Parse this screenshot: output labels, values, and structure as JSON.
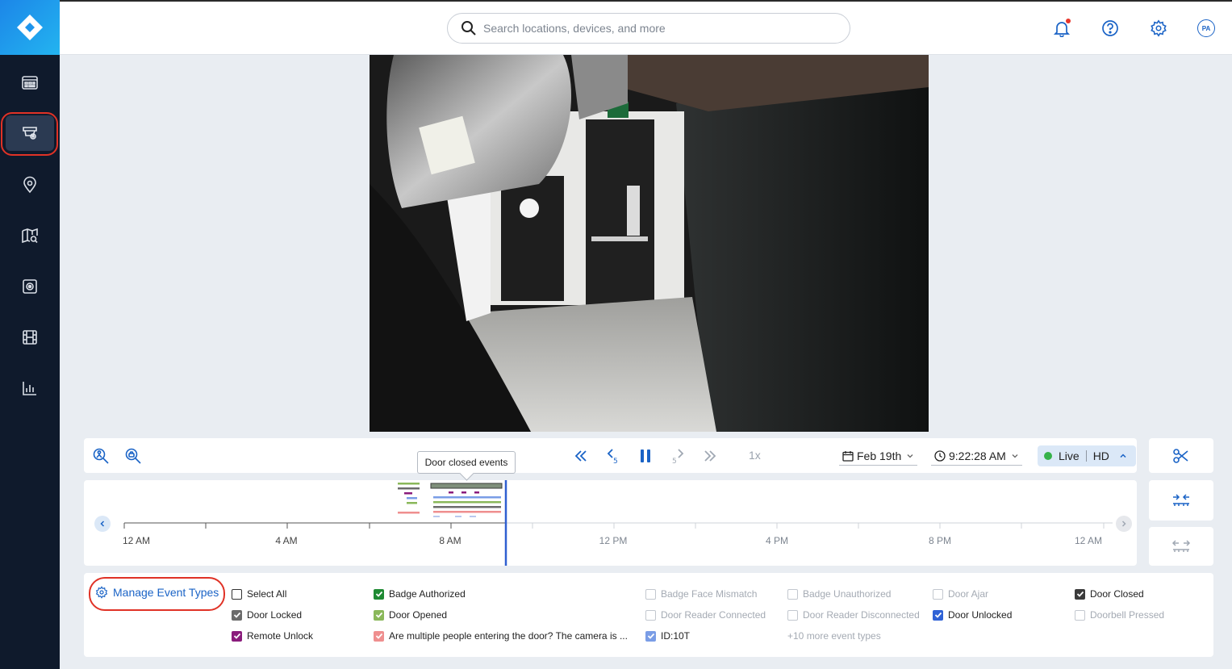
{
  "header": {
    "search_placeholder": "Search locations, devices, and more",
    "avatar_initials": "PA"
  },
  "sidebar": {
    "items": [
      "dashboard-icon",
      "cameras-icon",
      "locations-icon",
      "map-search-icon",
      "device-icon",
      "video-archive-icon",
      "analytics-icon"
    ],
    "active_item": "cameras-icon"
  },
  "controls": {
    "speed": "1x",
    "date": "Feb 19th",
    "time": "9:22:28 AM",
    "live_label": "Live",
    "quality_label": "HD",
    "live_color": "#36b24a"
  },
  "tooltip": {
    "text": "Door closed events"
  },
  "timeline": {
    "labels": [
      "12 AM",
      "4 AM",
      "8 AM",
      "12 PM",
      "4 PM",
      "8 PM",
      "12 AM"
    ],
    "playhead_color": "#2f5fd0"
  },
  "events": {
    "manage_label": "Manage Event Types",
    "more_label": "+10 more event types",
    "items": [
      {
        "label": "Select All",
        "checked": false,
        "color": "#333333",
        "disabled": false
      },
      {
        "label": "Door Locked",
        "checked": true,
        "color": "#6b6b6b",
        "disabled": false
      },
      {
        "label": "Remote Unlock",
        "checked": true,
        "color": "#8a1c7c",
        "disabled": false
      },
      {
        "label": "Badge Authorized",
        "checked": true,
        "color": "#1e8a32",
        "disabled": false
      },
      {
        "label": "Door Opened",
        "checked": true,
        "color": "#8ab85a",
        "disabled": false
      },
      {
        "label": "Are multiple people entering the door? The camera is ...",
        "checked": true,
        "color": "#ef8f8f",
        "disabled": false
      },
      {
        "label": "Badge Face Mismatch",
        "checked": false,
        "color": "#c3c8cf",
        "disabled": true
      },
      {
        "label": "Door Reader Connected",
        "checked": false,
        "color": "#c3c8cf",
        "disabled": true
      },
      {
        "label": "ID:10T",
        "checked": true,
        "color": "#7a9de6",
        "disabled": false
      },
      {
        "label": "Badge Unauthorized",
        "checked": false,
        "color": "#c3c8cf",
        "disabled": true
      },
      {
        "label": "Door Reader Disconnected",
        "checked": false,
        "color": "#c3c8cf",
        "disabled": true
      },
      {
        "label": "Door Ajar",
        "checked": false,
        "color": "#c3c8cf",
        "disabled": true
      },
      {
        "label": "Door Unlocked",
        "checked": true,
        "color": "#2f62d6",
        "disabled": false
      },
      {
        "label": "Door Closed",
        "checked": true,
        "color": "#3b3b3b",
        "disabled": false
      },
      {
        "label": "Doorbell Pressed",
        "checked": false,
        "color": "#c3c8cf",
        "disabled": true
      }
    ]
  }
}
